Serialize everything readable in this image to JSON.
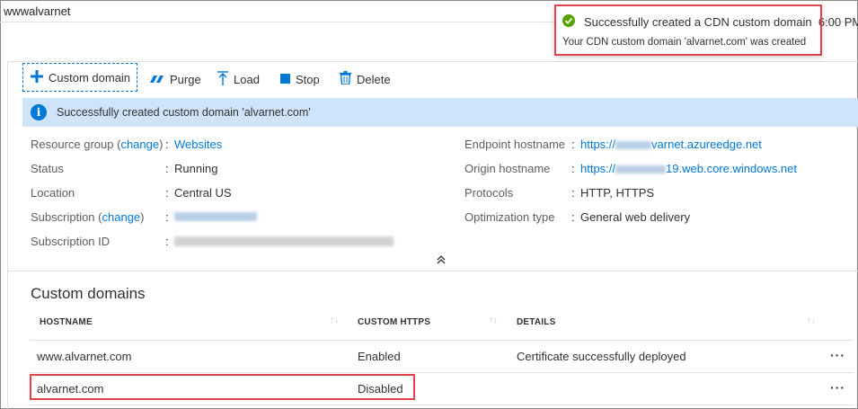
{
  "window": {
    "title": "wwwalvarnet"
  },
  "toast": {
    "title": "Successfully created a CDN custom domain",
    "time": "6:00 PM",
    "message": "Your CDN custom domain 'alvarnet.com' was created"
  },
  "toolbar": {
    "custom_domain": "Custom domain",
    "purge": "Purge",
    "load": "Load",
    "stop": "Stop",
    "delete": "Delete"
  },
  "banner": {
    "message": "Successfully created custom domain 'alvarnet.com'"
  },
  "essentials": {
    "resource_group_label": "Resource group",
    "change": "change",
    "resource_group_value": "Websites",
    "status_label": "Status",
    "status_value": "Running",
    "location_label": "Location",
    "location_value": "Central US",
    "subscription_label": "Subscription",
    "subscription_id_label": "Subscription ID",
    "endpoint_hostname_label": "Endpoint hostname",
    "endpoint_hostname_prefix": "https://",
    "endpoint_hostname_suffix": "varnet.azureedge.net",
    "origin_hostname_label": "Origin hostname",
    "origin_hostname_prefix": "https://",
    "origin_hostname_suffix": "19.web.core.windows.net",
    "protocols_label": "Protocols",
    "protocols_value": "HTTP, HTTPS",
    "optimization_label": "Optimization type",
    "optimization_value": "General web delivery"
  },
  "custom_domains": {
    "title": "Custom domains",
    "columns": [
      "HOSTNAME",
      "CUSTOM HTTPS",
      "DETAILS"
    ],
    "rows": [
      {
        "hostname": "www.alvarnet.com",
        "https": "Enabled",
        "details": "Certificate successfully deployed"
      },
      {
        "hostname": "alvarnet.com",
        "https": "Disabled",
        "details": ""
      }
    ]
  },
  "colors": {
    "accent": "#0078d4",
    "highlight": "#e0434b",
    "banner": "#cfe4fa",
    "success": "#57a300"
  }
}
